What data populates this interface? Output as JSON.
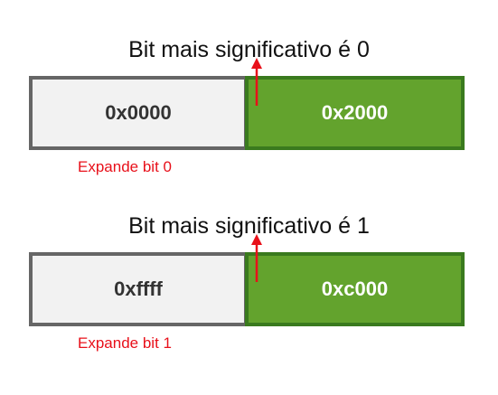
{
  "colors": {
    "left_fill": "#f2f2f2",
    "left_border": "#666666",
    "right_fill": "#63a32d",
    "right_border": "#3a7a1e",
    "caption": "#e8101a",
    "arrow": "#e8101a"
  },
  "blocks": [
    {
      "title": "Bit mais significativo é 0",
      "left_value": "0x0000",
      "right_value": "0x2000",
      "caption": "Expande bit 0"
    },
    {
      "title": "Bit mais significativo é 1",
      "left_value": "0xffff",
      "right_value": "0xc000",
      "caption": "Expande bit 1"
    }
  ]
}
